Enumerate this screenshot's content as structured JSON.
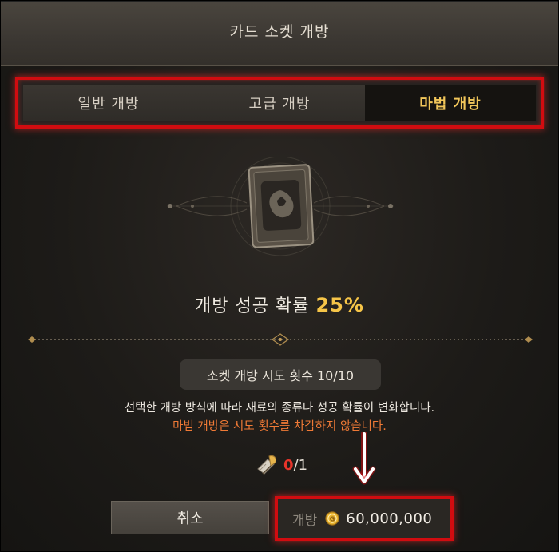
{
  "window": {
    "title": "카드 소켓 개방"
  },
  "tabs": [
    {
      "label": "일반 개방",
      "active": false
    },
    {
      "label": "고급 개방",
      "active": false
    },
    {
      "label": "마법 개방",
      "active": true
    }
  ],
  "rate": {
    "label": "개방 성공 확률",
    "value": "25%"
  },
  "attempts": {
    "text": "소켓 개방 시도 횟수 10/10"
  },
  "info": {
    "line1": "선택한 개방 방식에 따라 재료의 종류나 성공 확률이 변화합니다.",
    "line2": "마법 개방은 시도 횟수를 차감하지 않습니다."
  },
  "material": {
    "icon": "scroll-quill-icon",
    "have": "0",
    "need": "/1"
  },
  "buttons": {
    "cancel": "취소",
    "open": "개방",
    "cost": "60,000,000",
    "currency_icon": "gold-coin-icon"
  },
  "colors": {
    "highlight": "#d10c10",
    "accent_gold": "#f6c548",
    "warning_orange": "#f07a36",
    "material_missing": "#e8342a"
  }
}
